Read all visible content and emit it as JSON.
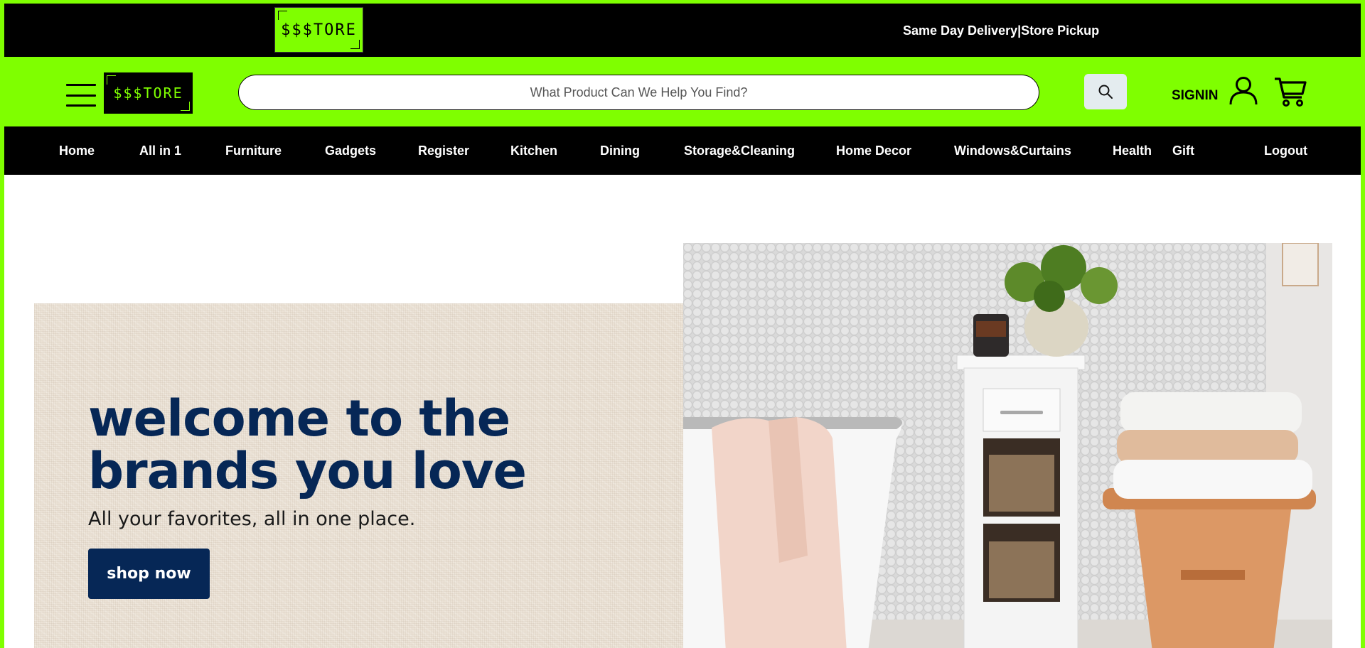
{
  "topbar": {
    "logo_text": "$$$TORE",
    "delivery_text": "Same Day Delivery|Store Pickup"
  },
  "header": {
    "logo_text": "$$$TORE",
    "search_placeholder": "What Product Can We Help You Find?",
    "signin_label": "SIGNIN"
  },
  "nav": {
    "items": [
      {
        "label": "Home"
      },
      {
        "label": "All in 1"
      },
      {
        "label": "Furniture"
      },
      {
        "label": "Gadgets"
      },
      {
        "label": "Register"
      },
      {
        "label": "Kitchen"
      },
      {
        "label": "Dining"
      },
      {
        "label": "Storage&Cleaning"
      },
      {
        "label": "Home Decor"
      },
      {
        "label": "Windows&Curtains"
      },
      {
        "label": "Health"
      },
      {
        "label": "Gift"
      },
      {
        "label": "Logout"
      }
    ]
  },
  "hero": {
    "title": "welcome to the brands you love",
    "subtitle": "All your favorites, all in one place.",
    "button_label": "shop now"
  },
  "colors": {
    "brand_green": "#7fff00",
    "navy": "#062756",
    "black": "#000000"
  },
  "icons": [
    "hamburger-icon",
    "search-icon",
    "user-icon",
    "cart-icon"
  ]
}
